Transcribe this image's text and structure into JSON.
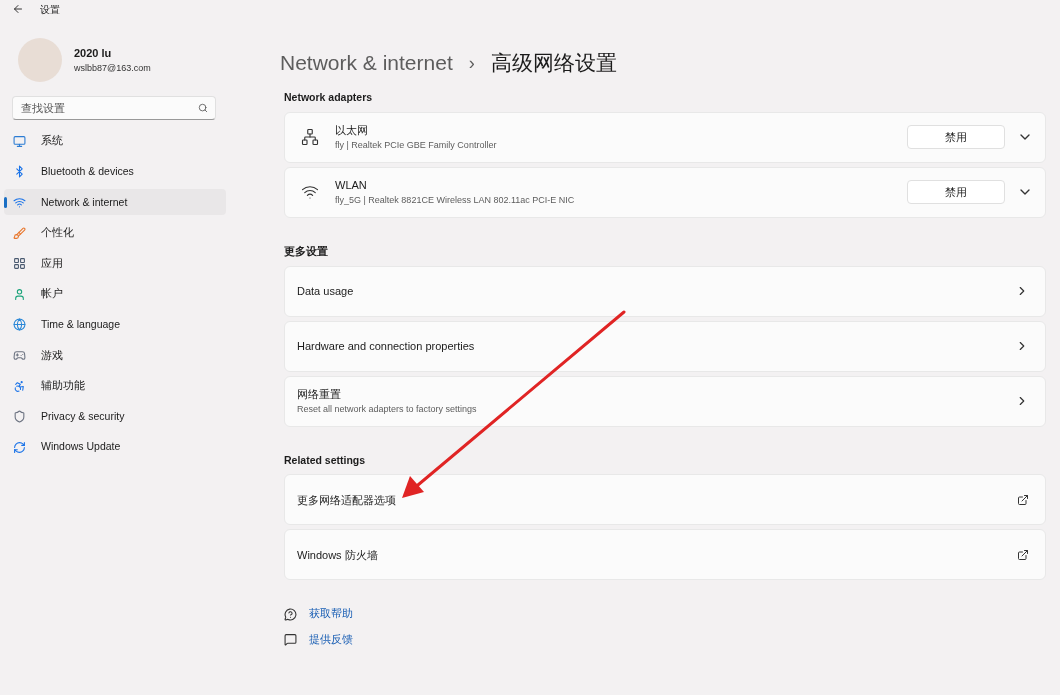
{
  "window": {
    "title": "设置"
  },
  "user": {
    "name": "2020 lu",
    "email": "wslbb87@163.com"
  },
  "search": {
    "placeholder": "查找设置"
  },
  "sidebar": {
    "items": [
      {
        "label": "系统",
        "selected": false
      },
      {
        "label": "Bluetooth & devices",
        "selected": false
      },
      {
        "label": "Network & internet",
        "selected": true
      },
      {
        "label": "个性化",
        "selected": false
      },
      {
        "label": "应用",
        "selected": false
      },
      {
        "label": "帐户",
        "selected": false
      },
      {
        "label": "Time & language",
        "selected": false
      },
      {
        "label": "游戏",
        "selected": false
      },
      {
        "label": "辅助功能",
        "selected": false
      },
      {
        "label": "Privacy & security",
        "selected": false
      },
      {
        "label": "Windows Update",
        "selected": false
      }
    ]
  },
  "breadcrumb": {
    "parent": "Network & internet",
    "separator": "›",
    "current": "高级网络设置"
  },
  "sections": [
    {
      "heading": "Network adapters",
      "items": [
        {
          "kind": "adapter",
          "title": "以太网",
          "subtitle": "fly | Realtek PCIe GBE Family Controller",
          "button": "禁用",
          "expanded": false
        },
        {
          "kind": "adapter",
          "title": "WLAN",
          "subtitle": "fly_5G | Realtek 8821CE Wireless LAN 802.11ac PCI-E NIC",
          "button": "禁用",
          "expanded": false
        }
      ]
    },
    {
      "heading": "更多设置",
      "items": [
        {
          "kind": "nav",
          "title": "Data usage"
        },
        {
          "kind": "nav",
          "title": "Hardware and connection properties"
        },
        {
          "kind": "nav",
          "title": "网络重置",
          "subtitle": "Reset all network adapters to factory settings"
        }
      ]
    },
    {
      "heading": "Related settings",
      "items": [
        {
          "kind": "external",
          "title": "更多网络适配器选项"
        },
        {
          "kind": "external",
          "title": "Windows 防火墙"
        }
      ]
    }
  ],
  "help_links": [
    "获取帮助",
    "提供反馈"
  ]
}
